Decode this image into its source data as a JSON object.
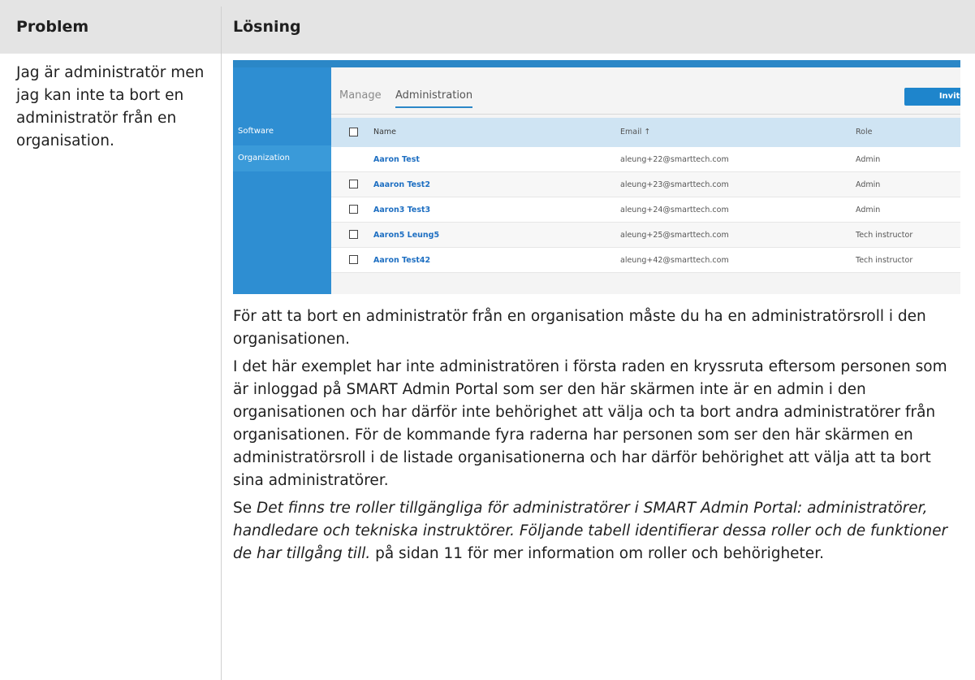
{
  "table": {
    "headers": [
      "Problem",
      "Lösning"
    ],
    "problem": "Jag är administratör men jag kan inte ta bort en administratör från en organisation."
  },
  "screenshot": {
    "tabs": [
      "Manage",
      "Administration"
    ],
    "invite_label": "Invite",
    "sidebar": [
      "Software",
      "Organization"
    ],
    "columns": [
      "Name",
      "Email ↑",
      "Role"
    ],
    "rows": [
      {
        "name": "Aaron Test",
        "email": "aleung+22@smarttech.com",
        "role": "Admin",
        "has_checkbox": false
      },
      {
        "name": "Aaaron Test2",
        "email": "aleung+23@smarttech.com",
        "role": "Admin",
        "has_checkbox": true
      },
      {
        "name": "Aaron3 Test3",
        "email": "aleung+24@smarttech.com",
        "role": "Admin",
        "has_checkbox": true
      },
      {
        "name": "Aaron5 Leung5",
        "email": "aleung+25@smarttech.com",
        "role": "Tech instructor",
        "has_checkbox": true
      },
      {
        "name": "Aaron Test42",
        "email": "aleung+42@smarttech.com",
        "role": "Tech instructor",
        "has_checkbox": true
      }
    ]
  },
  "solution": {
    "p1": "För att ta bort en administratör från en organisation måste du ha en administratörsroll i den organisationen.",
    "p2": "I det här exemplet har inte administratören i första raden en kryssruta eftersom personen som är inloggad på SMART Admin Portal som ser den här skärmen inte är en admin i den organisationen och har därför inte behörighet att välja och ta bort andra administratörer från organisationen. För de kommande fyra raderna har personen som ser den här skärmen en administratörsroll i de listade organisationerna och har därför behörighet att välja att ta bort sina administratörer.",
    "p3_prefix": "Se ",
    "p3_italic": "Det finns tre roller tillgängliga för administratörer i SMART Admin Portal: administratörer, handledare och tekniska instruktörer. Följande tabell identifierar dessa roller och de funktioner de har tillgång till.",
    "p3_suffix": " på sidan 11 för mer information om roller och behörigheter."
  }
}
